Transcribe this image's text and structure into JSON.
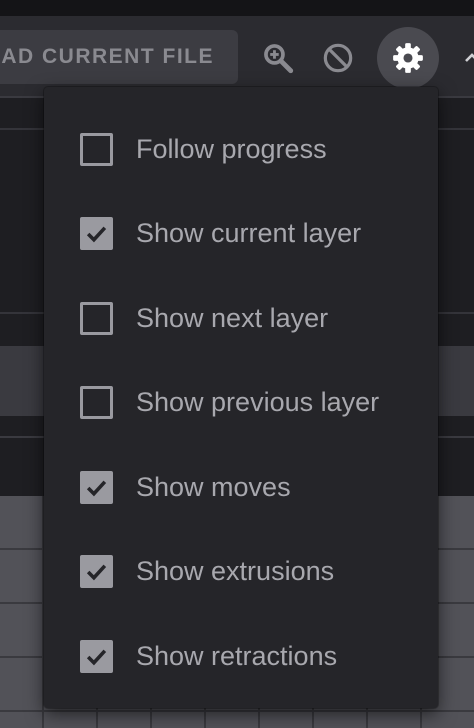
{
  "toolbar": {
    "load_label": "AD CURRENT FILE",
    "icons": [
      "zoom-in-icon",
      "block-icon",
      "gear-icon",
      "chevron-up-icon"
    ]
  },
  "menu": {
    "items": [
      {
        "label": "Follow progress",
        "checked": false
      },
      {
        "label": "Show current layer",
        "checked": true
      },
      {
        "label": "Show next layer",
        "checked": false
      },
      {
        "label": "Show previous layer",
        "checked": false
      },
      {
        "label": "Show moves",
        "checked": true
      },
      {
        "label": "Show extrusions",
        "checked": true
      },
      {
        "label": "Show retractions",
        "checked": true
      }
    ]
  },
  "colors": {
    "menu_bg": "#252529",
    "text": "#a8a8ae",
    "checkbox": "#9a9aa0",
    "check_mark": "#252529"
  }
}
